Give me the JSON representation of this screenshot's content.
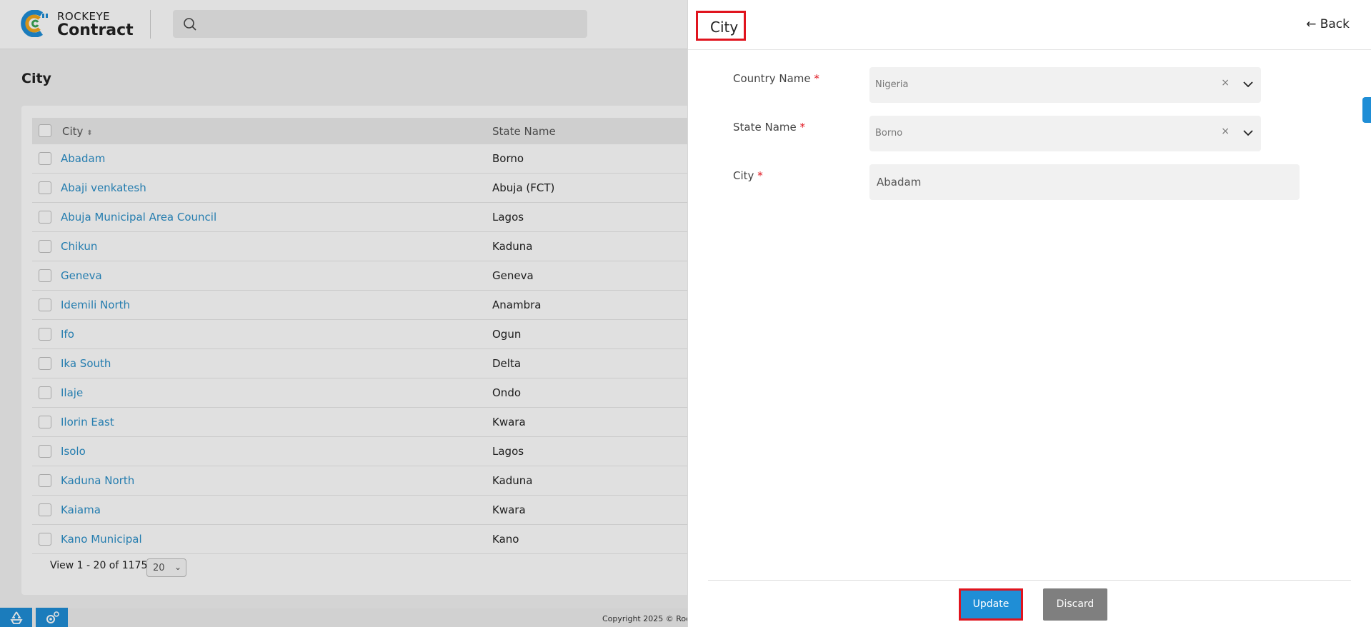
{
  "app": {
    "brand_top": "ROCKEYE",
    "brand_bottom": "Contract",
    "search_placeholder": ""
  },
  "page": {
    "title": "City",
    "columns": {
      "city": "City",
      "state": "State Name"
    },
    "rows": [
      {
        "city": "Abadam",
        "state": "Borno"
      },
      {
        "city": "Abaji venkatesh",
        "state": "Abuja (FCT)"
      },
      {
        "city": "Abuja Municipal Area Council",
        "state": "Lagos"
      },
      {
        "city": "Chikun",
        "state": "Kaduna"
      },
      {
        "city": "Geneva",
        "state": "Geneva"
      },
      {
        "city": "Idemili North",
        "state": "Anambra"
      },
      {
        "city": "Ifo",
        "state": "Ogun"
      },
      {
        "city": "Ika South",
        "state": "Delta"
      },
      {
        "city": "Ilaje",
        "state": "Ondo"
      },
      {
        "city": "Ilorin East",
        "state": "Kwara"
      },
      {
        "city": "Isolo",
        "state": "Lagos"
      },
      {
        "city": "Kaduna North",
        "state": "Kaduna"
      },
      {
        "city": "Kaiama",
        "state": "Kwara"
      },
      {
        "city": "Kano Municipal",
        "state": "Kano"
      }
    ],
    "pager_text": "View 1 - 20 of 1175",
    "page_size": "20",
    "copyright": "Copyright 2025 © Rock"
  },
  "panel": {
    "title": "City",
    "back_label": "Back",
    "fields": {
      "country": {
        "label": "Country Name",
        "required": "*",
        "value": "Nigeria",
        "clear": "×"
      },
      "state": {
        "label": "State Name",
        "required": "*",
        "value": "Borno",
        "clear": "×"
      },
      "city": {
        "label": "City",
        "required": "*",
        "value": "Abadam"
      }
    },
    "update_label": "Update",
    "discard_label": "Discard"
  },
  "colors": {
    "accent": "#1f8ed6",
    "link": "#2b8fc8",
    "highlight": "#e0141e",
    "discard": "#7f7f7f"
  }
}
